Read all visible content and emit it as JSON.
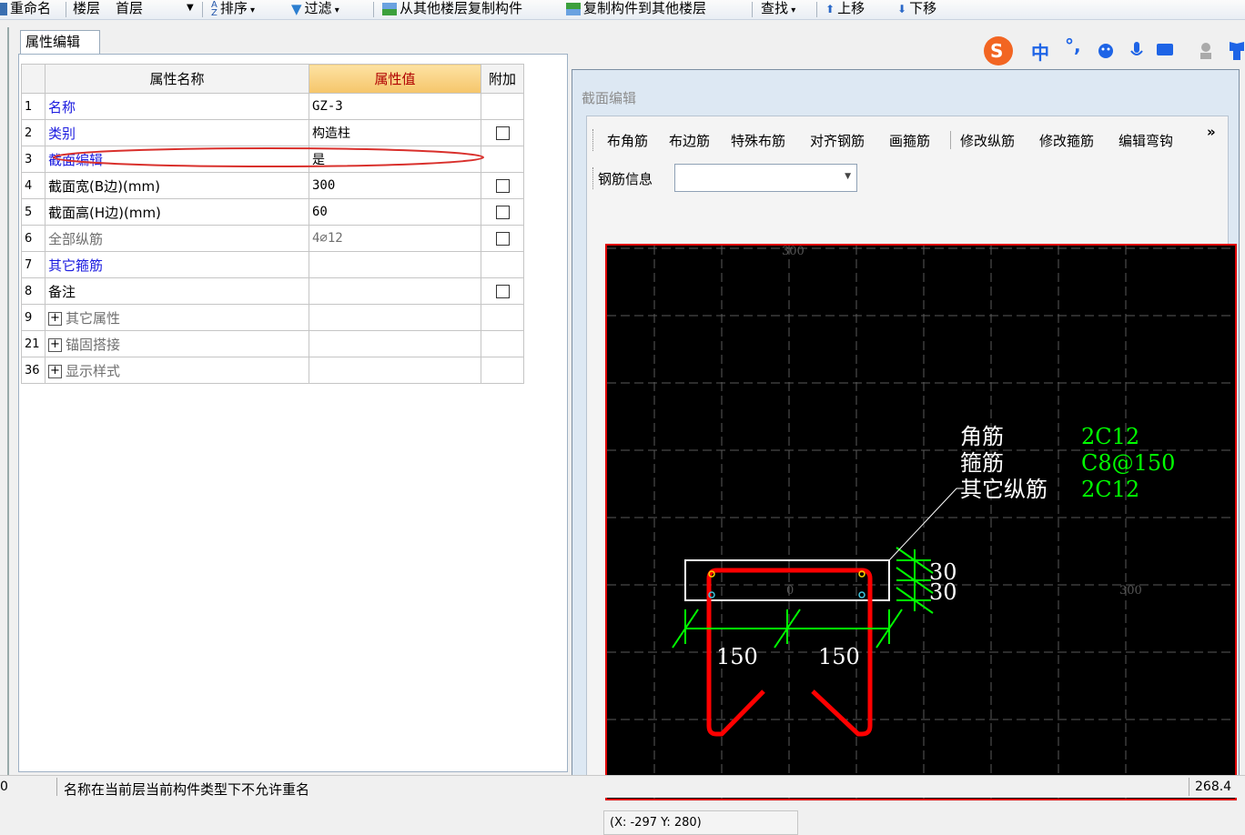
{
  "toolbar": {
    "rename": "重命名",
    "floor_label": "楼层",
    "floor_value": "首层",
    "sort": "排序",
    "filter": "过滤",
    "copy_from": "从其他楼层复制构件",
    "copy_to": "复制构件到其他楼层",
    "find": "查找",
    "move_up": "上移",
    "move_down": "下移"
  },
  "tab": {
    "label": "属性编辑"
  },
  "ime": {
    "mode": "中",
    "punct": "°,"
  },
  "grid": {
    "headers": {
      "name": "属性名称",
      "value": "属性值",
      "extra": "附加"
    },
    "rows": [
      {
        "num": "1",
        "name": "名称",
        "value": "GZ-3"
      },
      {
        "num": "2",
        "name": "类别",
        "value": "构造柱"
      },
      {
        "num": "3",
        "name": "截面编辑",
        "value": "是"
      },
      {
        "num": "4",
        "name": "截面宽(B边)(mm)",
        "value": "300"
      },
      {
        "num": "5",
        "name": "截面高(H边)(mm)",
        "value": "60"
      },
      {
        "num": "6",
        "name": "全部纵筋",
        "value": "4⌀12"
      },
      {
        "num": "7",
        "name": "其它箍筋",
        "value": ""
      },
      {
        "num": "8",
        "name": "备注",
        "value": ""
      },
      {
        "num": "9",
        "name": "其它属性",
        "value": ""
      },
      {
        "num": "21",
        "name": "锚固搭接",
        "value": ""
      },
      {
        "num": "36",
        "name": "显示样式",
        "value": ""
      }
    ]
  },
  "section_editor": {
    "title": "截面编辑",
    "tools": [
      "布角筋",
      "布边筋",
      "特殊布筋",
      "对齐钢筋",
      "画箍筋",
      "修改纵筋",
      "修改箍筋",
      "编辑弯钩"
    ],
    "more": "»",
    "rebar_info_label": "钢筋信息",
    "rebar_info_value": "",
    "coord": "(X: -297 Y: 280)"
  },
  "drawing": {
    "axis_labels": {
      "top": "300",
      "center": "0",
      "right": "300"
    },
    "legend": [
      {
        "label": "角筋",
        "value": "2C12"
      },
      {
        "label": "箍筋",
        "value": "C8@150"
      },
      {
        "label": "其它纵筋",
        "value": "2C12"
      }
    ],
    "dim_bottom_left": "150",
    "dim_bottom_right": "150",
    "dim_right_top": "30",
    "dim_right_bottom": "30",
    "colors": {
      "rebar": "#ff0000",
      "dimension": "#00ff00",
      "outline": "#ffffff"
    }
  },
  "status": {
    "left": "0",
    "message": "名称在当前层当前构件类型下不允许重名",
    "right": "268.4"
  }
}
